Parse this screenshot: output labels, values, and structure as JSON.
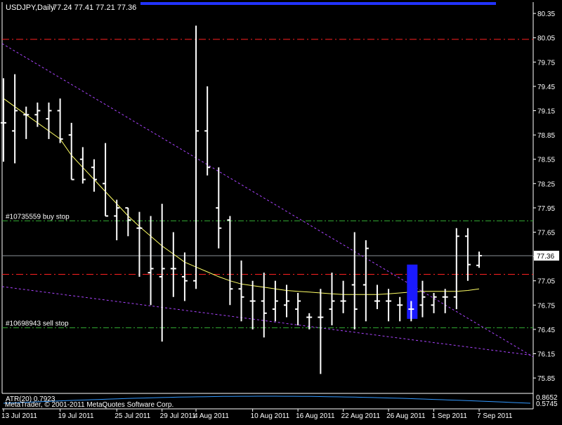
{
  "header": {
    "symbol": "USDJPY,Daily",
    "ohlc": "77.24 77.41 77.21 77.36"
  },
  "colors": {
    "background": "#000000",
    "bars": "#ffffff",
    "ma": "#ffff66",
    "trend": "#aa44ff",
    "red_level": "#ff2020",
    "green_level": "#33aa33",
    "highlight": "#1a1aff",
    "atr": "#3399ff"
  },
  "chart_data": {
    "type": "ohlc",
    "y_range": [
      75.66,
      80.49
    ],
    "y_ticks": [
      "80.35",
      "80.05",
      "79.75",
      "79.45",
      "79.15",
      "78.85",
      "78.55",
      "78.25",
      "77.95",
      "77.65",
      "77.35",
      "77.05",
      "76.75",
      "76.45",
      "76.15",
      "75.85"
    ],
    "current_price": "77.36",
    "x_ticks": [
      {
        "i": 0,
        "label": "13 Jul 2011"
      },
      {
        "i": 5,
        "label": "19 Jul 2011"
      },
      {
        "i": 10,
        "label": "25 Jul 2011"
      },
      {
        "i": 14,
        "label": "29 Jul 2011"
      },
      {
        "i": 17,
        "label": "4 Aug 2011"
      },
      {
        "i": 22,
        "label": "10 Aug 2011"
      },
      {
        "i": 26,
        "label": "16 Aug 2011"
      },
      {
        "i": 30,
        "label": "22 Aug 2011"
      },
      {
        "i": 34,
        "label": "26 Aug 2011"
      },
      {
        "i": 38,
        "label": "1 Sep 2011"
      },
      {
        "i": 42,
        "label": "7 Sep 2011"
      }
    ],
    "bars": [
      {
        "h": 79.55,
        "l": 78.52,
        "o": 79.0,
        "c": 79.0
      },
      {
        "h": 79.6,
        "l": 78.5,
        "o": 78.9,
        "c": 79.15
      },
      {
        "h": 79.2,
        "l": 78.8,
        "o": 79.1,
        "c": 79.1
      },
      {
        "h": 79.25,
        "l": 78.95,
        "o": 79.1,
        "c": 79.15
      },
      {
        "h": 79.25,
        "l": 78.8,
        "o": 79.05,
        "c": 79.15
      },
      {
        "h": 79.3,
        "l": 78.75,
        "o": 79.15,
        "c": 78.8
      },
      {
        "h": 79.0,
        "l": 78.3,
        "o": 78.85,
        "c": 78.3
      },
      {
        "h": 78.7,
        "l": 78.25,
        "o": 78.55,
        "c": 78.3
      },
      {
        "h": 78.55,
        "l": 78.15,
        "o": 78.45,
        "c": 78.3
      },
      {
        "h": 78.75,
        "l": 77.85,
        "o": 78.25,
        "c": 77.85
      },
      {
        "h": 78.05,
        "l": 77.55,
        "o": 77.85,
        "c": 77.95
      },
      {
        "h": 77.95,
        "l": 77.6,
        "o": 77.95,
        "c": 77.8
      },
      {
        "h": 77.9,
        "l": 77.1,
        "o": 77.7,
        "c": 77.7
      },
      {
        "h": 77.85,
        "l": 76.75,
        "o": 77.15,
        "c": 77.2
      },
      {
        "h": 78.0,
        "l": 76.3,
        "o": 77.1,
        "c": 77.2
      },
      {
        "h": 77.65,
        "l": 76.85,
        "o": 77.2,
        "c": 77.2
      },
      {
        "h": 77.4,
        "l": 76.8,
        "o": 77.1,
        "c": 77.05
      },
      {
        "h": 80.2,
        "l": 76.95,
        "o": 77.05,
        "c": 78.9
      },
      {
        "h": 79.45,
        "l": 78.35,
        "o": 78.9,
        "c": 78.45
      },
      {
        "h": 78.45,
        "l": 77.45,
        "o": 77.95,
        "c": 77.7
      },
      {
        "h": 77.85,
        "l": 76.75,
        "o": 77.8,
        "c": 76.95
      },
      {
        "h": 77.3,
        "l": 76.55,
        "o": 76.95,
        "c": 76.85
      },
      {
        "h": 77.05,
        "l": 76.45,
        "o": 76.8,
        "c": 76.8
      },
      {
        "h": 77.15,
        "l": 76.35,
        "o": 76.8,
        "c": 76.65
      },
      {
        "h": 77.05,
        "l": 76.55,
        "o": 76.7,
        "c": 76.8
      },
      {
        "h": 77.0,
        "l": 76.6,
        "o": 76.75,
        "c": 76.8
      },
      {
        "h": 76.9,
        "l": 76.5,
        "o": 76.7,
        "c": 76.8
      },
      {
        "h": 76.65,
        "l": 76.45,
        "o": 76.6,
        "c": 76.6
      },
      {
        "h": 76.95,
        "l": 75.9,
        "o": 76.6,
        "c": 76.6
      },
      {
        "h": 77.15,
        "l": 76.5,
        "o": 76.7,
        "c": 76.8
      },
      {
        "h": 77.05,
        "l": 76.65,
        "o": 76.8,
        "c": 76.8
      },
      {
        "h": 77.65,
        "l": 76.45,
        "o": 77.0,
        "c": 76.7
      },
      {
        "h": 77.55,
        "l": 76.55,
        "o": 77.0,
        "c": 77.45
      },
      {
        "h": 77.0,
        "l": 76.7,
        "o": 76.8,
        "c": 76.8
      },
      {
        "h": 76.95,
        "l": 76.55,
        "o": 76.8,
        "c": 76.8
      },
      {
        "h": 76.85,
        "l": 76.55,
        "o": 76.75,
        "c": 76.75
      },
      {
        "h": 76.8,
        "l": 76.55,
        "o": 76.7,
        "c": 76.7
      },
      {
        "h": 77.05,
        "l": 76.6,
        "o": 76.75,
        "c": 76.85
      },
      {
        "h": 76.9,
        "l": 76.65,
        "o": 76.75,
        "c": 76.85
      },
      {
        "h": 76.95,
        "l": 76.65,
        "o": 76.85,
        "c": 76.85
      },
      {
        "h": 77.7,
        "l": 76.7,
        "o": 76.85,
        "c": 77.6
      },
      {
        "h": 77.7,
        "l": 77.05,
        "o": 77.6,
        "c": 77.25
      },
      {
        "h": 77.41,
        "l": 77.21,
        "o": 77.24,
        "c": 77.36
      }
    ],
    "ma": [
      79.3,
      79.2,
      79.1,
      79.0,
      78.9,
      78.8,
      78.6,
      78.45,
      78.3,
      78.15,
      78.0,
      77.85,
      77.72,
      77.6,
      77.48,
      77.38,
      77.28,
      77.22,
      77.16,
      77.1,
      77.05,
      77.01,
      76.99,
      76.97,
      76.95,
      76.93,
      76.92,
      76.91,
      76.9,
      76.89,
      76.88,
      76.88,
      76.88,
      76.88,
      76.89,
      76.9,
      76.91,
      76.92,
      76.92,
      76.92,
      76.92,
      76.93,
      76.95
    ],
    "lines": [
      {
        "name": "#10735559 buy stop",
        "value": 77.79,
        "style": "green"
      },
      {
        "name": "#10698943 sell stop",
        "value": 76.47,
        "style": "green"
      },
      {
        "value": 80.03,
        "style": "red"
      },
      {
        "value": 77.13,
        "style": "red"
      },
      {
        "value": 77.36,
        "style": "current"
      }
    ],
    "highlight": {
      "index": 36,
      "top": 77.25,
      "bottom": 76.58
    },
    "atr": {
      "label": "ATR(20) 0.7923",
      "upper": "0.8652",
      "lower": "0.5745"
    }
  },
  "copyright": "MetaTrader, © 2001-2011 MetaQuotes Software Corp."
}
